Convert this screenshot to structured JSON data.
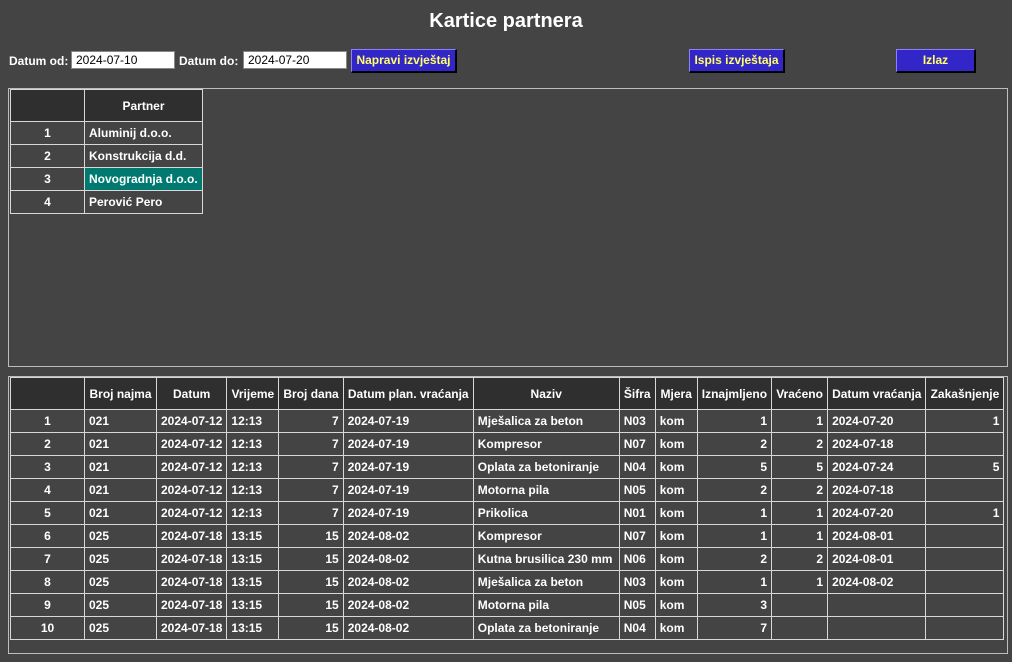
{
  "title": "Kartice partnera",
  "filters": {
    "date_from_label": "Datum od:",
    "date_from_value": "2024-07-10",
    "date_to_label": "Datum do:",
    "date_to_value": "2024-07-20"
  },
  "buttons": {
    "make_report": "Napravi izvještaj",
    "print_report": "Ispis izvještaja",
    "exit": "Izlaz"
  },
  "partners": {
    "header": "Partner",
    "rows": [
      {
        "no": "1",
        "name": "Aluminij d.o.o."
      },
      {
        "no": "2",
        "name": "Konstrukcija d.d."
      },
      {
        "no": "3",
        "name": "Novogradnja d.o.o."
      },
      {
        "no": "4",
        "name": "Perović Pero"
      }
    ],
    "selected_index": 2
  },
  "details": {
    "columns": [
      "",
      "Broj najma",
      "Datum",
      "Vrijeme",
      "Broj dana",
      "Datum plan. vraćanja",
      "Naziv",
      "Šifra",
      "Mjera",
      "Iznajmljeno",
      "Vraćeno",
      "Datum vraćanja",
      "Zakašnjenje"
    ],
    "rows": [
      {
        "no": "1",
        "broj": "021",
        "datum": "2024-07-12",
        "vrijeme": "12:13",
        "dani": "7",
        "plan": "2024-07-19",
        "naziv": "Mješalica za beton",
        "sifra": "N03",
        "mjera": "kom",
        "izn": "1",
        "vra": "1",
        "dvr": "2024-07-20",
        "zak": "1"
      },
      {
        "no": "2",
        "broj": "021",
        "datum": "2024-07-12",
        "vrijeme": "12:13",
        "dani": "7",
        "plan": "2024-07-19",
        "naziv": "Kompresor",
        "sifra": "N07",
        "mjera": "kom",
        "izn": "2",
        "vra": "2",
        "dvr": "2024-07-18",
        "zak": ""
      },
      {
        "no": "3",
        "broj": "021",
        "datum": "2024-07-12",
        "vrijeme": "12:13",
        "dani": "7",
        "plan": "2024-07-19",
        "naziv": "Oplata za betoniranje",
        "sifra": "N04",
        "mjera": "kom",
        "izn": "5",
        "vra": "5",
        "dvr": "2024-07-24",
        "zak": "5"
      },
      {
        "no": "4",
        "broj": "021",
        "datum": "2024-07-12",
        "vrijeme": "12:13",
        "dani": "7",
        "plan": "2024-07-19",
        "naziv": "Motorna pila",
        "sifra": "N05",
        "mjera": "kom",
        "izn": "2",
        "vra": "2",
        "dvr": "2024-07-18",
        "zak": ""
      },
      {
        "no": "5",
        "broj": "021",
        "datum": "2024-07-12",
        "vrijeme": "12:13",
        "dani": "7",
        "plan": "2024-07-19",
        "naziv": "Prikolica",
        "sifra": "N01",
        "mjera": "kom",
        "izn": "1",
        "vra": "1",
        "dvr": "2024-07-20",
        "zak": "1"
      },
      {
        "no": "6",
        "broj": "025",
        "datum": "2024-07-18",
        "vrijeme": "13:15",
        "dani": "15",
        "plan": "2024-08-02",
        "naziv": "Kompresor",
        "sifra": "N07",
        "mjera": "kom",
        "izn": "1",
        "vra": "1",
        "dvr": "2024-08-01",
        "zak": ""
      },
      {
        "no": "7",
        "broj": "025",
        "datum": "2024-07-18",
        "vrijeme": "13:15",
        "dani": "15",
        "plan": "2024-08-02",
        "naziv": "Kutna brusilica 230 mm",
        "sifra": "N06",
        "mjera": "kom",
        "izn": "2",
        "vra": "2",
        "dvr": "2024-08-01",
        "zak": ""
      },
      {
        "no": "8",
        "broj": "025",
        "datum": "2024-07-18",
        "vrijeme": "13:15",
        "dani": "15",
        "plan": "2024-08-02",
        "naziv": "Mješalica za beton",
        "sifra": "N03",
        "mjera": "kom",
        "izn": "1",
        "vra": "1",
        "dvr": "2024-08-02",
        "zak": ""
      },
      {
        "no": "9",
        "broj": "025",
        "datum": "2024-07-18",
        "vrijeme": "13:15",
        "dani": "15",
        "plan": "2024-08-02",
        "naziv": "Motorna pila",
        "sifra": "N05",
        "mjera": "kom",
        "izn": "3",
        "vra": "",
        "dvr": "",
        "zak": ""
      },
      {
        "no": "10",
        "broj": "025",
        "datum": "2024-07-18",
        "vrijeme": "13:15",
        "dani": "15",
        "plan": "2024-08-02",
        "naziv": "Oplata za betoniranje",
        "sifra": "N04",
        "mjera": "kom",
        "izn": "7",
        "vra": "",
        "dvr": "",
        "zak": ""
      }
    ]
  },
  "colors": {
    "background": "#444444",
    "button_bg": "#3326c8",
    "button_text": "#ffff66",
    "selected_row": "#007a70"
  }
}
